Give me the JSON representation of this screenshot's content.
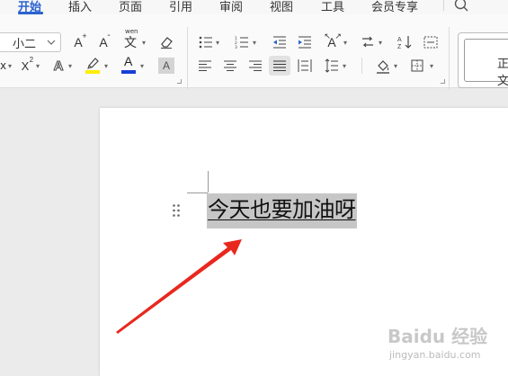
{
  "menu": {
    "tabs": [
      {
        "label": "开始",
        "active": true
      },
      {
        "label": "插入"
      },
      {
        "label": "页面"
      },
      {
        "label": "引用"
      },
      {
        "label": "审阅"
      },
      {
        "label": "视图"
      },
      {
        "label": "工具"
      },
      {
        "label": "会员专享"
      }
    ]
  },
  "ribbon": {
    "font_size_value": "小二",
    "font": {
      "grow_label": "A",
      "shrink_label": "A",
      "phonetic_label": "wen",
      "superscript_label": "X",
      "text_effect_label": "A",
      "highlight_label": "A",
      "font_color_label": "A",
      "char_shading_label": "A"
    },
    "styles": {
      "normal_label": "正文"
    }
  },
  "document": {
    "selected_text": "今天也要加油呀"
  },
  "watermark": {
    "brand": "Baidu 经验",
    "url": "jingyan.baidu.com"
  },
  "colors": {
    "accent": "#2b62cf",
    "highlight_yellow": "#ffee00",
    "font_color_blue": "#1a3fd6",
    "selection": "#c6c6c6",
    "arrow_red": "#e8281e"
  }
}
